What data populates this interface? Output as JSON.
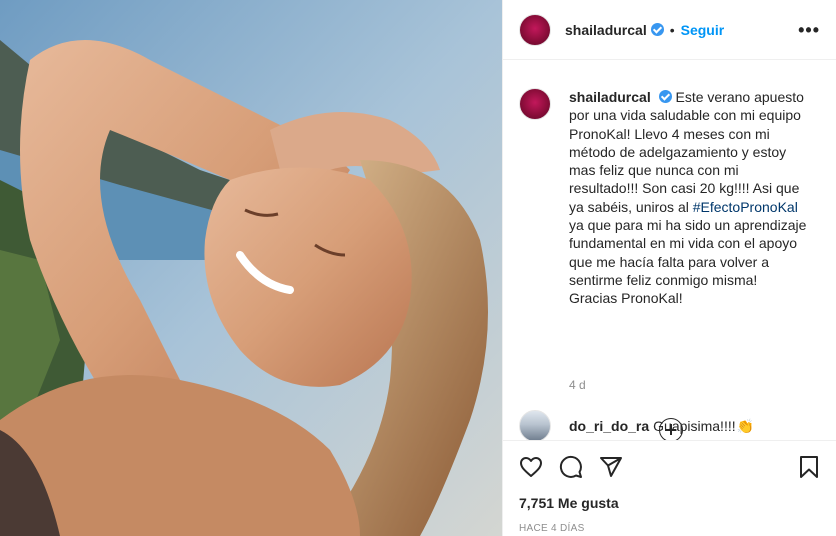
{
  "post": {
    "username": "shailadurcal",
    "follow_label": "Seguir",
    "separator": "•",
    "more_label": "•••"
  },
  "caption": {
    "username": "shailadurcal",
    "text_before": "Este verano apuesto por una vida saludable con mi equipo PronoKal! Llevo 4 meses con mi método de adelgazamiento y estoy mas feliz que nunca con mi resultado!!! Son casi 20 kg!!!! Asi que ya sabéis, uniros al",
    "hashtag": "#EfectoPronoKal",
    "text_after": "ya que para mi ha sido un aprendizaje fundamental en mi vida con el apoyo que me hacía falta para volver a sentirme feliz conmigo misma! Gracias PronoKal!",
    "time": "4 d"
  },
  "comments": [
    {
      "username": "do_ri_do_ra",
      "text": "Guapisima!!!!",
      "emoji": "👏"
    }
  ],
  "footer": {
    "likes": "7,751 Me gusta",
    "posted_ago": "HACE 4 DÍAS"
  },
  "icons": {
    "verified": "verified-badge-icon",
    "like": "heart-icon",
    "comment": "comment-bubble-icon",
    "share": "paper-plane-icon",
    "save": "bookmark-icon",
    "load_more": "plus-circle-icon"
  },
  "colors": {
    "accent": "#0095f6",
    "verified": "#3897f0",
    "hashtag": "#00376b",
    "muted": "#8e8e8e"
  }
}
